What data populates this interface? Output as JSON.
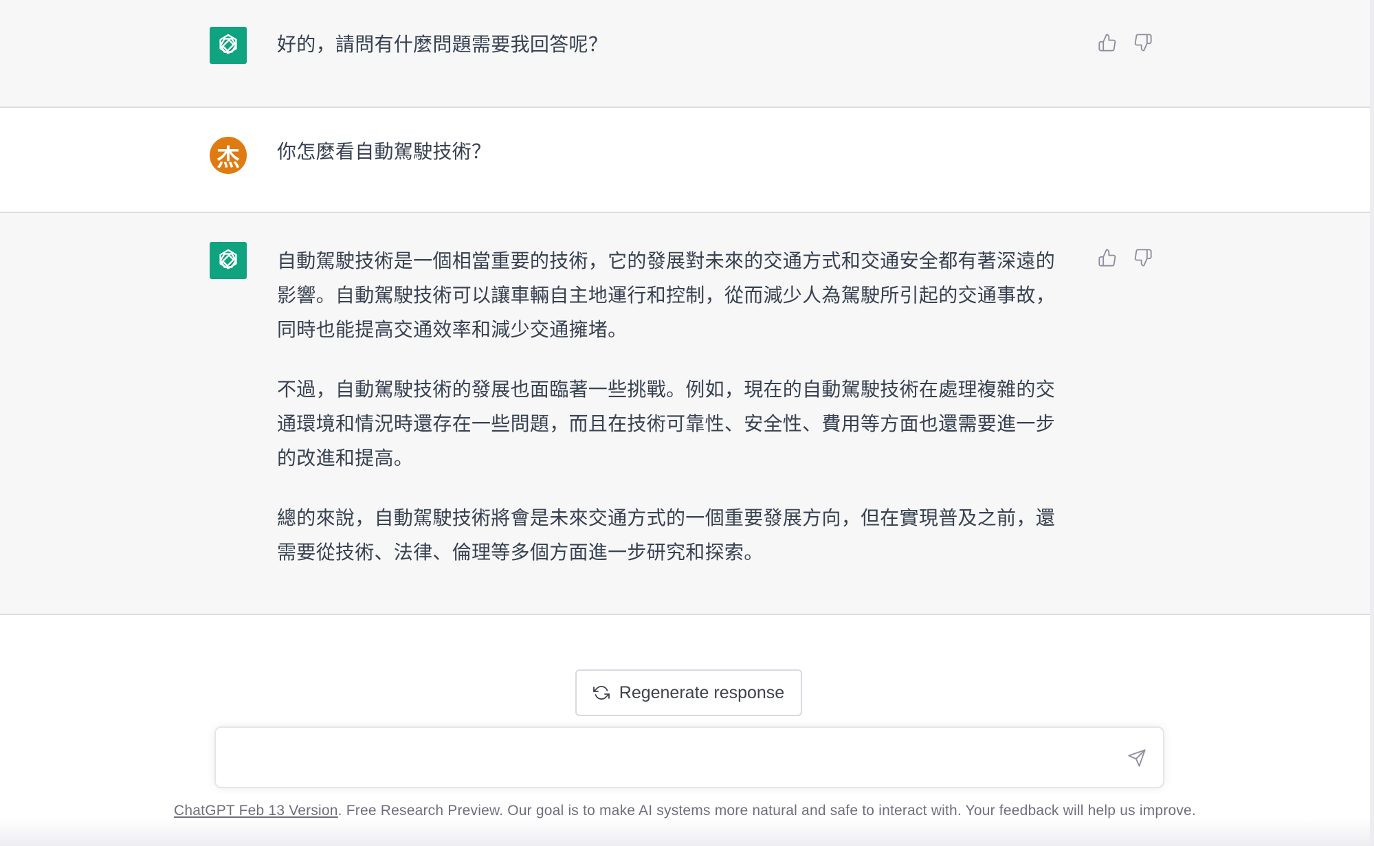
{
  "conversation": {
    "messages": [
      {
        "role": "assistant",
        "paragraphs": [
          "好的，請問有什麼問題需要我回答呢？"
        ]
      },
      {
        "role": "user",
        "avatar_text": "杰",
        "paragraphs": [
          "你怎麼看自動駕駛技術？"
        ]
      },
      {
        "role": "assistant",
        "paragraphs": [
          "自動駕駛技術是一個相當重要的技術，它的發展對未來的交通方式和交通安全都有著深遠的影響。自動駕駛技術可以讓車輛自主地運行和控制，從而減少人為駕駛所引起的交通事故，同時也能提高交通效率和減少交通擁堵。",
          "不過，自動駕駛技術的發展也面臨著一些挑戰。例如，現在的自動駕駛技術在處理複雜的交通環境和情況時還存在一些問題，而且在技術可靠性、安全性、費用等方面也還需要進一步的改進和提高。",
          "總的來說，自動駕駛技術將會是未來交通方式的一個重要發展方向，但在實現普及之前，還需要從技術、法律、倫理等多個方面進一步研究和探索。"
        ]
      }
    ]
  },
  "actions": {
    "regenerate_label": "Regenerate response"
  },
  "composer": {
    "value": "",
    "placeholder": ""
  },
  "footer": {
    "version_link": "ChatGPT Feb 13 Version",
    "disclaimer": ". Free Research Preview. Our goal is to make AI systems more natural and safe to interact with. Your feedback will help us improve."
  },
  "colors": {
    "assistant_bg": "#f7f7f8",
    "bot_avatar": "#10a37f",
    "user_avatar": "#e07b12"
  },
  "icons": {
    "bot_avatar": "openai-logo-icon",
    "like": "thumbs-up-icon",
    "dislike": "thumbs-down-icon",
    "regenerate": "refresh-icon",
    "send": "send-icon"
  }
}
